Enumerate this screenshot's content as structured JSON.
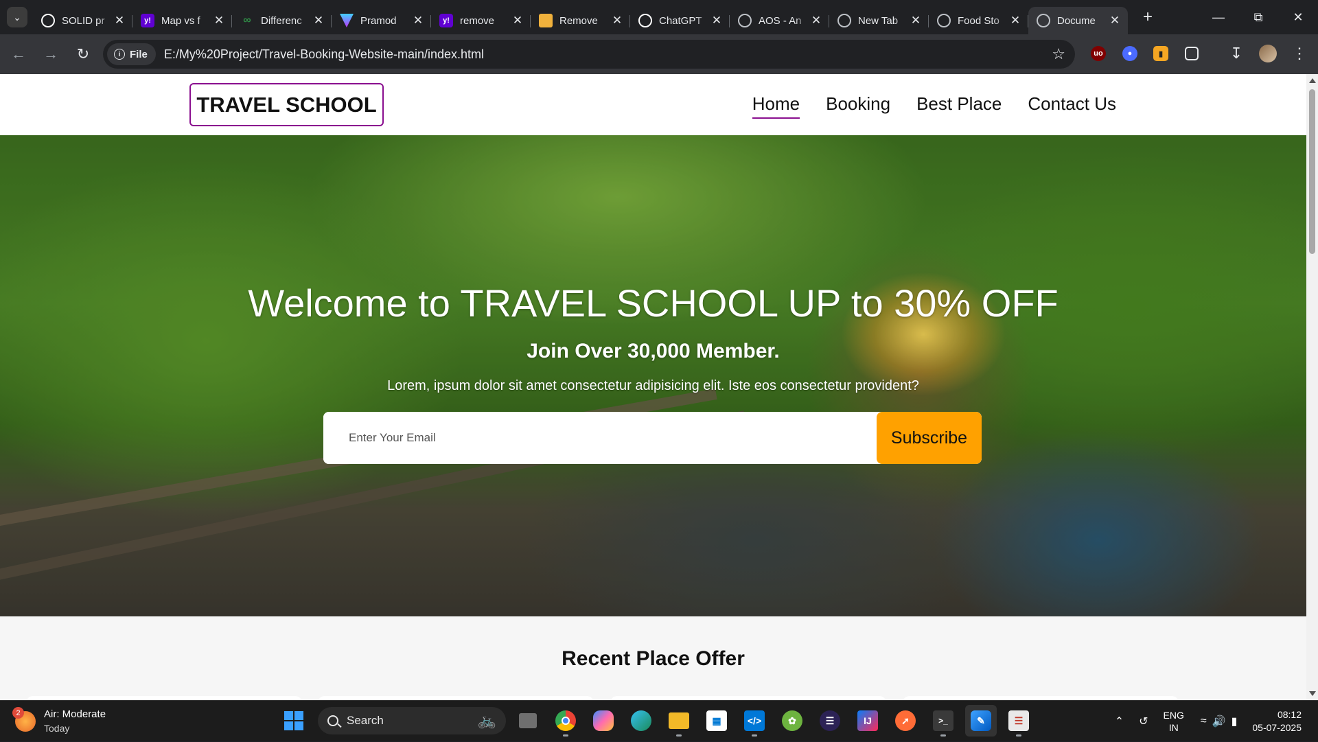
{
  "browser": {
    "tabs": [
      {
        "title": "SOLID pr",
        "icon": "openai-icon",
        "color": "#ffffff"
      },
      {
        "title": "Map vs f",
        "icon": "yahoo-icon",
        "color": "#6001d2"
      },
      {
        "title": "Differenc",
        "icon": "link-icon",
        "color": "#2f8d46"
      },
      {
        "title": "Pramod",
        "icon": "vite-icon",
        "color": "#9b59ff"
      },
      {
        "title": "remove",
        "icon": "yahoo-icon",
        "color": "#6001d2"
      },
      {
        "title": "Remove",
        "icon": "stack-icon",
        "color": "#f0b13c"
      },
      {
        "title": "ChatGPT",
        "icon": "openai-icon",
        "color": "#ffffff"
      },
      {
        "title": "AOS - An",
        "icon": "globe-icon",
        "color": "#bdc1c6"
      },
      {
        "title": "New Tab",
        "icon": "globe-icon",
        "color": "#bdc1c6"
      },
      {
        "title": "Food Sto",
        "icon": "globe-icon",
        "color": "#bdc1c6"
      },
      {
        "title": "Docume",
        "icon": "globe-icon",
        "color": "#bdc1c6",
        "active": true
      }
    ],
    "address": {
      "chip_label": "File",
      "url": "E:/My%20Project/Travel-Booking-Website-main/index.html"
    }
  },
  "site": {
    "logo": "TRAVEL SCHOOL",
    "nav": [
      "Home",
      "Booking",
      "Best Place",
      "Contact Us"
    ],
    "hero": {
      "title": "Welcome to TRAVEL SCHOOL UP to 30% OFF",
      "subtitle": "Join Over 30,000 Member.",
      "description": "Lorem, ipsum dolor sit amet consectetur adipisicing elit. Iste eos consectetur provident?",
      "email_placeholder": "Enter Your Email",
      "subscribe_label": "Subscribe"
    },
    "section_title": "Recent Place Offer"
  },
  "taskbar": {
    "weather_badge": "2",
    "weather_title": "Air: Moderate",
    "weather_sub": "Today",
    "search_label": "Search",
    "lang_top": "ENG",
    "lang_bottom": "IN",
    "time": "08:12",
    "date": "05-07-2025"
  },
  "colors": {
    "accent_purple": "#8a0f8f",
    "subscribe_orange": "#ffa100"
  }
}
